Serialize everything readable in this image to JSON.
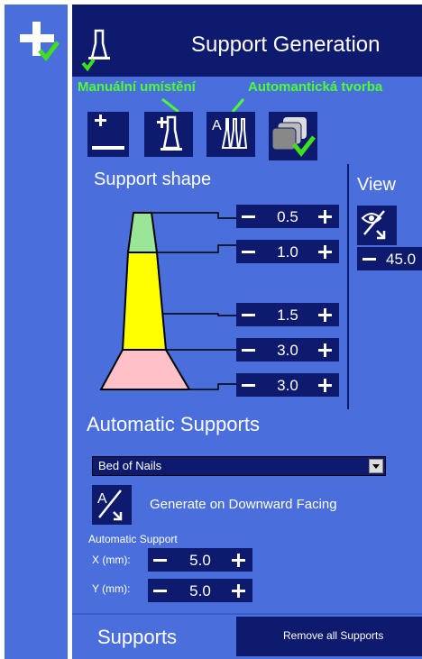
{
  "header": {
    "title": "Support Generation"
  },
  "annotations": {
    "manual": "Manuální umístění",
    "auto": "Automantická tvorba"
  },
  "support_shape": {
    "title": "Support shape",
    "values": [
      "0.5",
      "1.0",
      "1.5",
      "3.0",
      "3.0"
    ]
  },
  "view": {
    "title": "View",
    "angle": "45.0"
  },
  "automatic": {
    "title": "Automatic Supports",
    "dropdown_value": "Bed of Nails",
    "generate_label": "Generate on Downward Facing",
    "section_label": "Automatic Support",
    "x_label": "X (mm):",
    "x_value": "5.0",
    "y_label": "Y (mm):",
    "y_value": "5.0"
  },
  "supports": {
    "title": "Supports",
    "remove_label": "Remove all Supports"
  },
  "colors": {
    "panel": "#4a6fdd",
    "dark": "#0e1a6e",
    "green": "#4dff2e",
    "yellow": "#ffff00",
    "pink": "#ffc0c8",
    "lightgreen": "#99e699"
  },
  "icons": [
    "add-support-icon",
    "support-tool-icon",
    "manual-support-icon",
    "auto-support-icon",
    "layers-check-icon",
    "eye-view-icon",
    "auto-generate-icon"
  ]
}
